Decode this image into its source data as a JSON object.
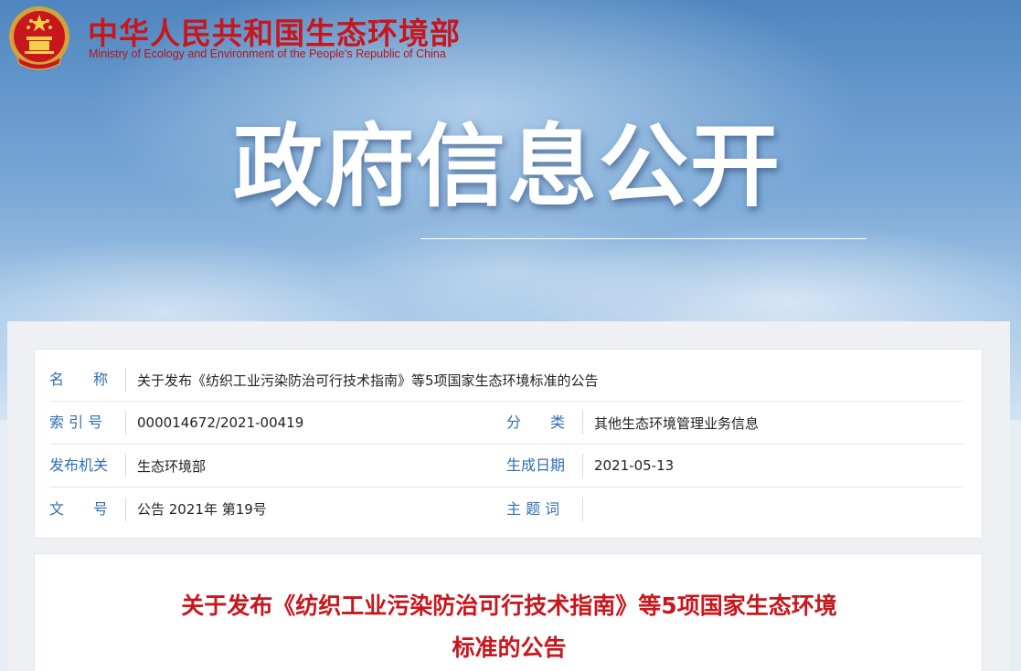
{
  "header": {
    "site_title_cn": "中华人民共和国生态环境部",
    "site_title_en": "Ministry of Ecology and Environment of the People's Republic of China",
    "emblem_icon": "national-emblem-icon",
    "section_title": "政府信息公开",
    "colors": {
      "brand_red": "#c8161d",
      "label_blue": "#2f6fb2"
    }
  },
  "info": {
    "name_label": "名　　称",
    "name_value": "关于发布《纺织工业污染防治可行技术指南》等5项国家生态环境标准的公告",
    "index_label": "索 引 号",
    "index_value": "000014672/2021-00419",
    "category_label": "分　　类",
    "category_value": "其他生态环境管理业务信息",
    "issuer_label": "发布机关",
    "issuer_value": "生态环境部",
    "date_label": "生成日期",
    "date_value": "2021-05-13",
    "doc_no_label": "文　　号",
    "doc_no_value": "公告 2021年 第19号",
    "keywords_label": "主 题 词",
    "keywords_value": ""
  },
  "article": {
    "title_line1": "关于发布《纺织工业污染防治可行技术指南》等5项国家生态环境",
    "title_line2": "标准的公告"
  }
}
